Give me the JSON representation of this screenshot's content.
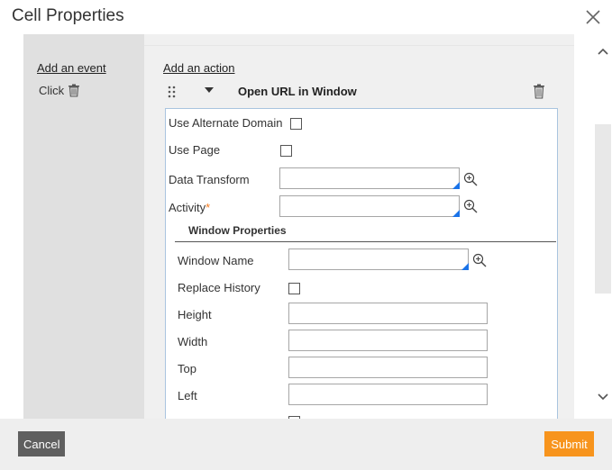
{
  "dialog": {
    "title": "Cell Properties",
    "close_icon": "close-icon"
  },
  "events": {
    "add_event_label": "Add an event",
    "items": [
      {
        "label": "Click",
        "icon": "trash-icon"
      }
    ]
  },
  "actions": {
    "add_action_label": "Add an action",
    "current": {
      "name": "Open URL in Window",
      "drag_icon": "drag-handle-icon",
      "expand_icon": "caret-down-icon",
      "delete_icon": "trash-icon"
    }
  },
  "form": {
    "use_alternate_domain": {
      "label": "Use Alternate Domain",
      "checked": false
    },
    "use_page": {
      "label": "Use Page",
      "checked": false
    },
    "data_transform": {
      "label": "Data Transform",
      "value": ""
    },
    "activity": {
      "label": "Activity",
      "required_mark": "*",
      "value": ""
    },
    "window_properties": {
      "title": "Window Properties",
      "window_name": {
        "label": "Window Name",
        "value": ""
      },
      "replace_history": {
        "label": "Replace History",
        "checked": false
      },
      "height": {
        "label": "Height",
        "value": ""
      },
      "width": {
        "label": "Width",
        "value": ""
      },
      "top": {
        "label": "Top",
        "value": ""
      },
      "left": {
        "label": "Left",
        "value": ""
      }
    }
  },
  "footer": {
    "cancel_label": "Cancel",
    "submit_label": "Submit"
  },
  "colors": {
    "accent": "#f7941d",
    "cancel": "#5f5f5f",
    "required": "#f47b20",
    "field_corner": "#1a73e8"
  }
}
